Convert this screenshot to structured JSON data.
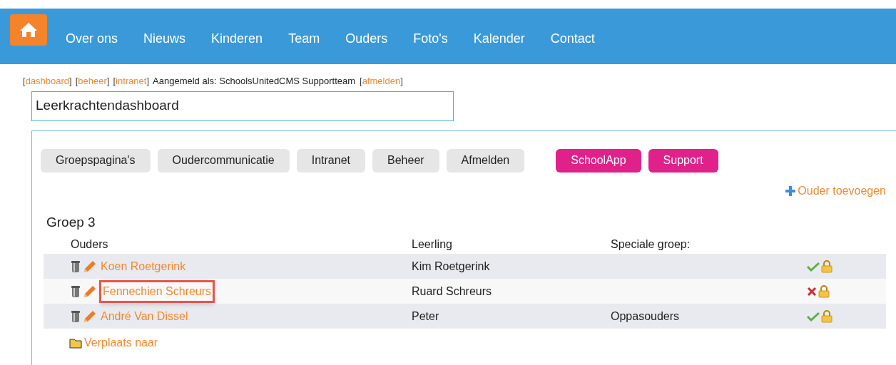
{
  "nav": {
    "items": [
      "Over ons",
      "Nieuws",
      "Kinderen",
      "Team",
      "Ouders",
      "Foto's",
      "Kalender",
      "Contact"
    ]
  },
  "userbar": [
    {
      "kind": "link",
      "open": "[",
      "text": "dashboard",
      "close": "]"
    },
    {
      "kind": "link",
      "open": "[",
      "text": "beheer",
      "close": "]"
    },
    {
      "kind": "link",
      "open": "[",
      "text": "intranet",
      "close": "]"
    },
    {
      "kind": "text",
      "text": "Aangemeld als: SchoolsUnitedCMS Supportteam"
    },
    {
      "kind": "link",
      "open": "[",
      "text": "afmelden",
      "close": "]"
    }
  ],
  "title": "Leerkrachtendashboard",
  "buttons": [
    {
      "label": "Groepspagina's",
      "kind": "default"
    },
    {
      "label": "Oudercommunicatie",
      "kind": "default"
    },
    {
      "label": "Intranet",
      "kind": "default"
    },
    {
      "label": "Beheer",
      "kind": "default"
    },
    {
      "label": "Afmelden",
      "kind": "default"
    },
    {
      "label": "SchoolApp",
      "kind": "accent"
    },
    {
      "label": "Support",
      "kind": "accent"
    }
  ],
  "add_link": "Ouder toevoegen",
  "group": {
    "title": "Groep 3",
    "columns": [
      "Ouders",
      "Leerling",
      "Speciale groep:"
    ],
    "rows": [
      {
        "parent": "Koen Roetgerink",
        "student": "Kim Roetgerink",
        "approved": true,
        "highlighted": false
      },
      {
        "parent": "Fennechien Schreurs",
        "student": "Ruard Schreurs",
        "approved": false,
        "highlighted": true
      },
      {
        "parent": "André Van Dissel",
        "student": "Peter",
        "special": "Oppasouders",
        "approved": true,
        "highlighted": false
      }
    ]
  },
  "move_link": "Verplaats naar"
}
